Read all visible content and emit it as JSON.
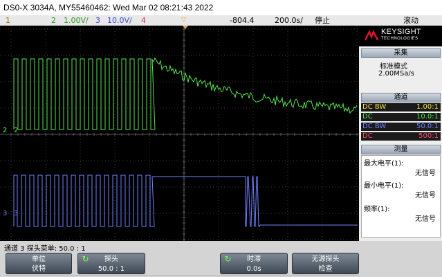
{
  "title": "DS0-X 3034A, MY55460462: Wed Mar 02 08:21:43 2022",
  "status": {
    "ch1": "1",
    "ch2_num": "2",
    "ch2_scale": "1.00V/",
    "ch3_num": "3",
    "ch3_scale": "10.0V/",
    "ch4_num": "4",
    "trig_delay": "-804.4",
    "timebase": "200.0s/",
    "run_state": "停止",
    "trig_mode": "滚动"
  },
  "colors": {
    "ch1": "#f3e04a",
    "ch2": "#56e84e",
    "ch3": "#7181ff",
    "ch4": "#ff4f6e",
    "trig_marker": "#e8a33a"
  },
  "markers": {
    "ch2_label": "2",
    "ch3_label": "3"
  },
  "sidebar": {
    "brand": "KEYSIGHT",
    "brand_sub": "TECHNOLOGIES",
    "acq_head": "采集",
    "acq_mode": "标准模式",
    "acq_rate": "2.00MSa/s",
    "chan_head": "通道",
    "channels": [
      {
        "coupling": "DC BW",
        "probe": "1.00:1"
      },
      {
        "coupling": "DC",
        "probe": "10.0:1"
      },
      {
        "coupling": "DC BW",
        "probe": "50.0:1"
      },
      {
        "coupling": "DC",
        "probe": "500:1"
      }
    ],
    "meas_head": "测量",
    "measurements": [
      {
        "label": "最大电平(1):",
        "value": "无信号"
      },
      {
        "label": "最小电平(1):",
        "value": "无信号"
      },
      {
        "label": "频率(1):",
        "value": "无信号"
      }
    ]
  },
  "bottom": {
    "chan_info": "通道 3 探头菜单: 50.0 : 1",
    "keys": [
      {
        "top": "单位",
        "bottom": "伏特"
      },
      {
        "top": "探头",
        "bottom": "50.0 : 1"
      },
      {
        "top": "时滞",
        "bottom": "0.0s"
      },
      {
        "top": "无源探头",
        "bottom": "检查"
      }
    ]
  }
}
